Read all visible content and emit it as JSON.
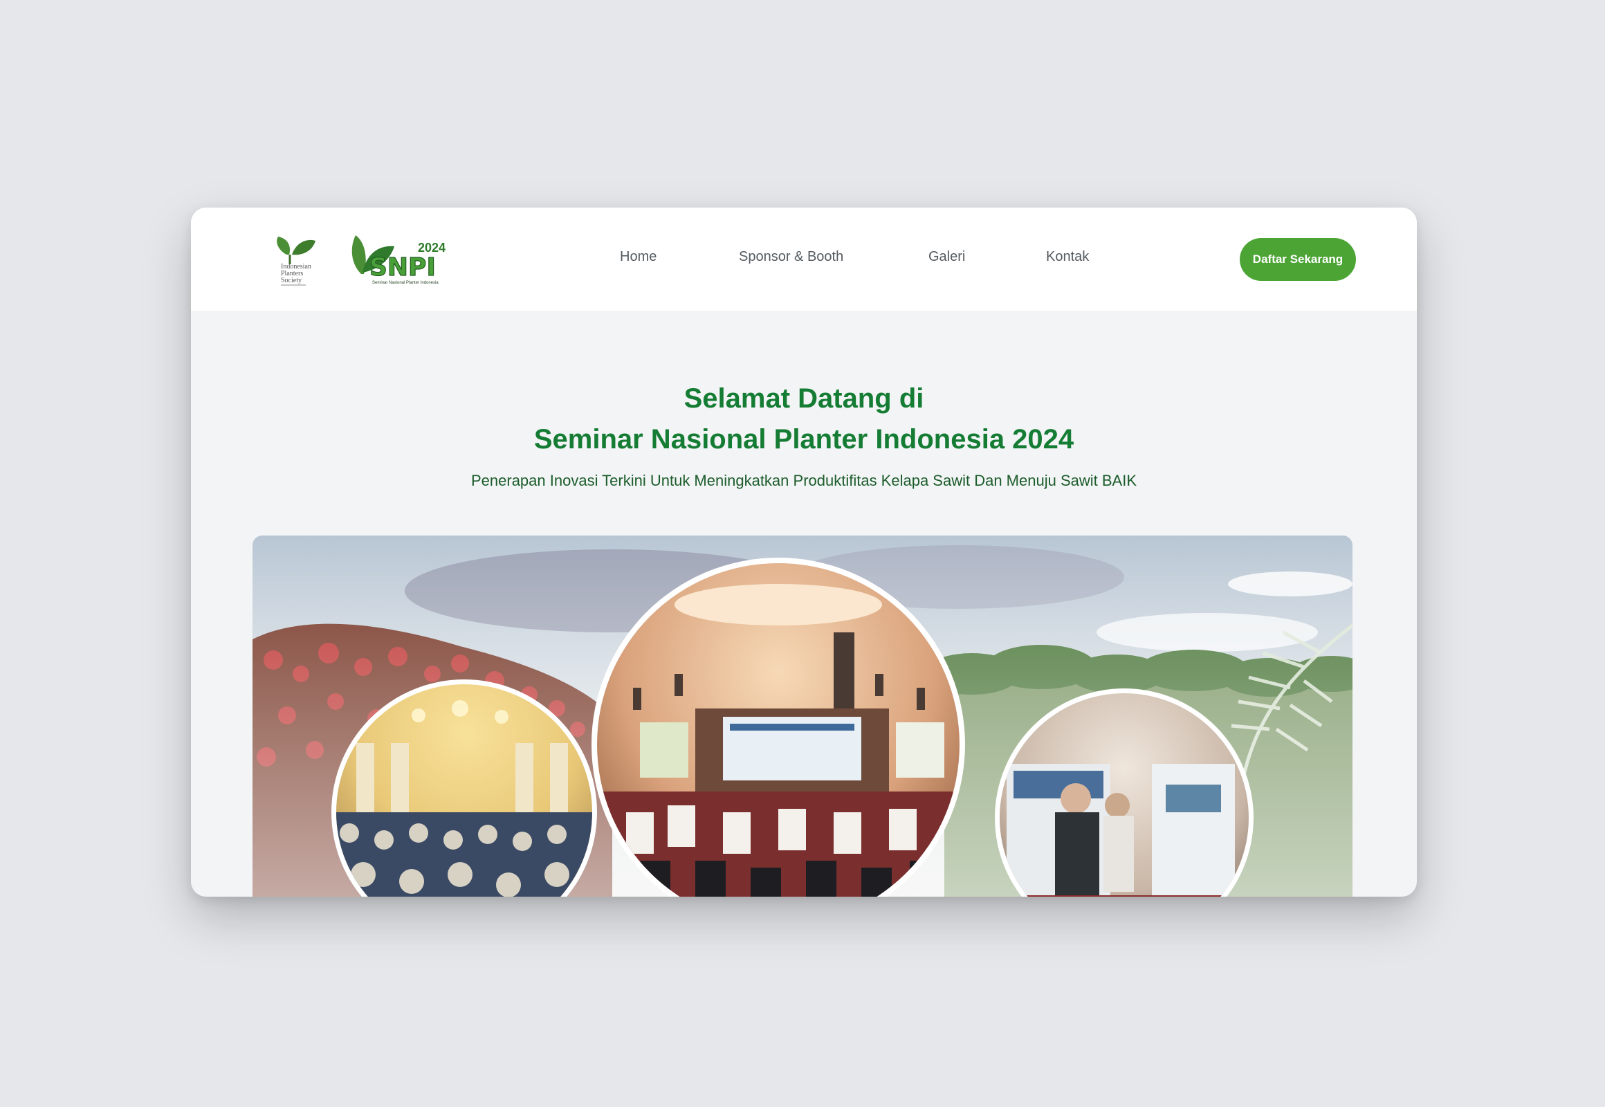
{
  "logos": {
    "ips_text": [
      "Indonesian",
      "Planters",
      "Society"
    ],
    "snpi_year": "2024",
    "snpi_word": "SNPI",
    "snpi_caption": "Seminar Nasional Planter Indonesia"
  },
  "nav": {
    "items": [
      "Home",
      "Sponsor & Booth",
      "Galeri",
      "Kontak"
    ],
    "cta_label": "Daftar Sekarang"
  },
  "hero": {
    "title_line1": "Selamat Datang di",
    "title_line2": "Seminar Nasional Planter Indonesia 2024",
    "subtitle": "Penerapan Inovasi Terkini Untuk Meningkatkan Produktifitas Kelapa Sawit Dan Menuju Sawit BAIK"
  },
  "colors": {
    "brand_green": "#157c34",
    "cta_green": "#4ca435",
    "page_bg": "#e5e7eb"
  }
}
